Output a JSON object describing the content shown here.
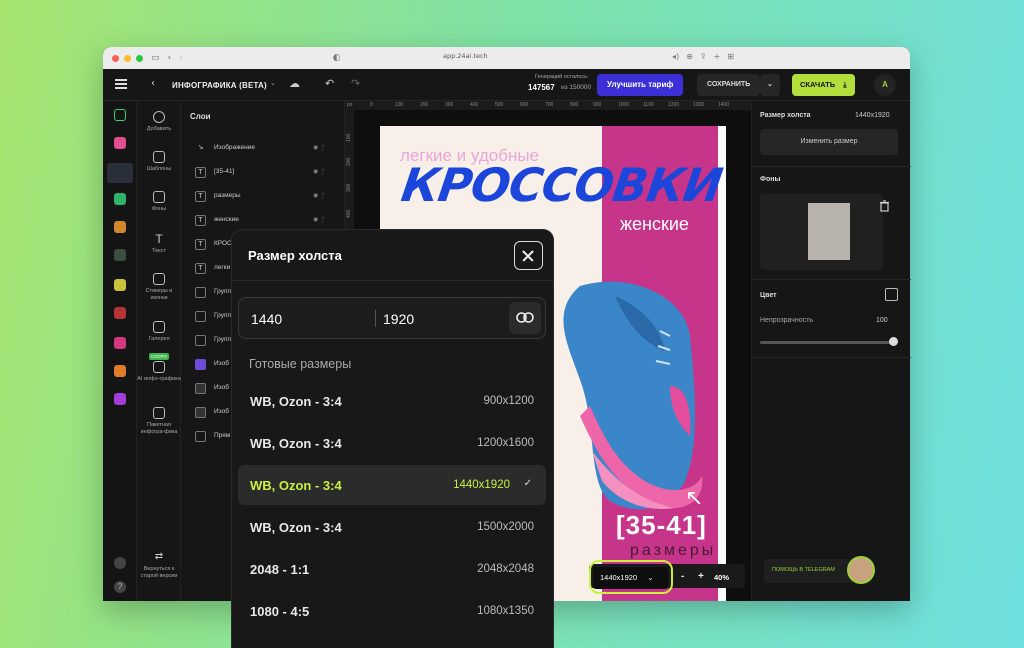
{
  "browser": {
    "url": "app.24ai.tech"
  },
  "topbar": {
    "project_title": "ИНФОГРАФИКА (BETA)",
    "generations_label": "Генераций осталось:",
    "generations_count": "147567",
    "generations_of": "из 150000",
    "upgrade_label": "Улучшить тариф",
    "save_label": "СОХРАНИТЬ",
    "download_label": "СКАЧАТЬ",
    "avatar_letter": "A"
  },
  "tools": [
    {
      "label": "Добавить"
    },
    {
      "label": "Шаблоны"
    },
    {
      "label": "Фоны"
    },
    {
      "label": "Текст"
    },
    {
      "label": "Стикеры и иконки"
    },
    {
      "label": "Галерея"
    },
    {
      "label": "AI инфо-графика",
      "badge": "СКОРО"
    },
    {
      "label": "Пакетная инфогра-фика"
    }
  ],
  "tools_back": "Вернуться к старой версии",
  "layers": {
    "title": "Слои",
    "items": [
      {
        "name": "Изображение",
        "icon": "image"
      },
      {
        "name": "[35-41]",
        "icon": "T"
      },
      {
        "name": "размеры",
        "icon": "T"
      },
      {
        "name": "женские",
        "icon": "T"
      },
      {
        "name": "КРОС",
        "icon": "T"
      },
      {
        "name": "легки",
        "icon": "T"
      },
      {
        "name": "Групп",
        "icon": "group"
      },
      {
        "name": "Групп",
        "icon": "group"
      },
      {
        "name": "Групп",
        "icon": "group"
      },
      {
        "name": "Изоб",
        "icon": "image"
      },
      {
        "name": "Изоб",
        "icon": "image"
      },
      {
        "name": "Изоб",
        "icon": "image"
      },
      {
        "name": "Прям",
        "icon": "rect"
      }
    ]
  },
  "ruler": {
    "unit": "px",
    "top_ticks": [
      "0",
      "100",
      "200",
      "300",
      "400",
      "500",
      "600",
      "700",
      "800",
      "900",
      "1000",
      "1100",
      "1200",
      "1300",
      "1400"
    ],
    "left_ticks": [
      "100",
      "200",
      "300",
      "400"
    ]
  },
  "poster": {
    "subtitle": "легкие и удобные",
    "headline": "КРОССОВКИ",
    "tag": "женские",
    "size_range": "[35-41]",
    "size_word": "размеры"
  },
  "right_panel": {
    "canvas_size_label": "Размер холста",
    "canvas_size_value": "1440x1920",
    "change_size_label": "Изменить размер",
    "backgrounds_label": "Фоны",
    "color_label": "Цвет",
    "opacity_label": "Непрозрачность",
    "opacity_value": "100",
    "help_label": "ПОМОЩЬ В TELEGRAM"
  },
  "bottom": {
    "size_selector": "1440x1920",
    "zoom_minus": "-",
    "zoom_plus": "+",
    "zoom_value": "40%"
  },
  "modal": {
    "title": "Размер холста",
    "width": "1440",
    "height": "1920",
    "presets_label": "Готовые размеры",
    "presets": [
      {
        "name": "WB, Ozon - 3:4",
        "size": "900x1200",
        "selected": false
      },
      {
        "name": "WB, Ozon - 3:4",
        "size": "1200x1600",
        "selected": false
      },
      {
        "name": "WB, Ozon - 3:4",
        "size": "1440x1920",
        "selected": true
      },
      {
        "name": "WB, Ozon - 3:4",
        "size": "1500x2000",
        "selected": false
      },
      {
        "name": "2048 - 1:1",
        "size": "2048x2048",
        "selected": false
      },
      {
        "name": "1080 - 4:5",
        "size": "1080x1350",
        "selected": false
      }
    ]
  },
  "colors": {
    "accent": "#c9f03f",
    "upgrade": "#3b2fd6",
    "poster_pink": "#c6358a",
    "poster_blue": "#1c46d9"
  }
}
